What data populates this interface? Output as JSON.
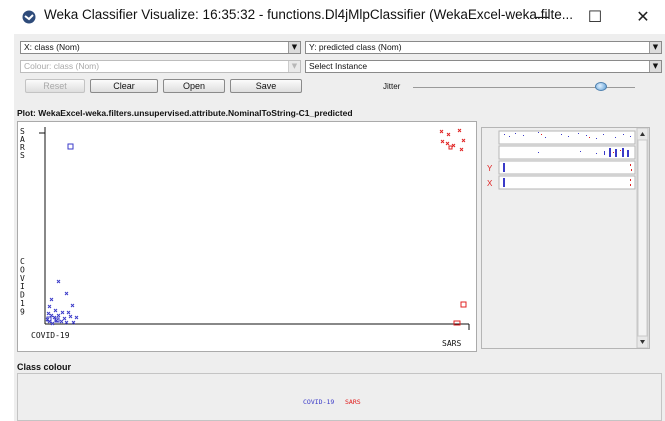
{
  "window": {
    "title": "Weka Classifier Visualize: 16:35:32 - functions.Dl4jMlpClassifier (WekaExcel-weka.filte...",
    "controls": {
      "minimize": "—",
      "maximize": "☐",
      "close": "✕"
    }
  },
  "controls": {
    "x_axis": "X: class (Nom)",
    "y_axis": "Y: predicted class (Nom)",
    "colour": "Colour: class (Nom)",
    "select_instance": "Select Instance",
    "reset_label": "Reset",
    "clear_label": "Clear",
    "open_label": "Open",
    "save_label": "Save",
    "jitter_label": "Jitter"
  },
  "plot": {
    "title": "Plot: WekaExcel-weka.filters.unsupervised.attribute.NominalToString-C1_predicted",
    "y_axis_top": "SARS",
    "y_axis_bottom": "COVID19",
    "x_axis_left": "COVID-19",
    "x_axis_right": "SARS",
    "side_y_label": "Y",
    "side_x_label": "X"
  },
  "legend": {
    "title": "Class colour",
    "items": [
      {
        "label": "COVID-19",
        "color": "#3a3ac8"
      },
      {
        "label": "SARS",
        "color": "#e02020"
      }
    ]
  },
  "colors": {
    "covid": "#3a3ac8",
    "sars": "#e02020"
  }
}
